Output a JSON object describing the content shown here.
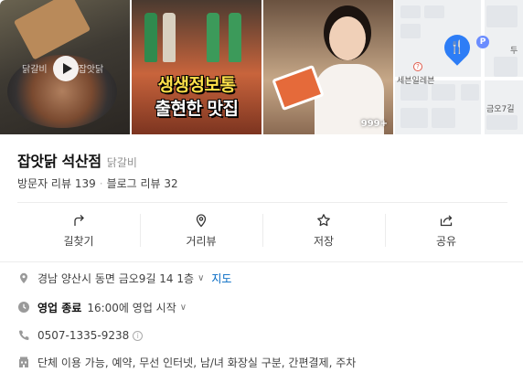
{
  "gallery": {
    "video_caption_left": "닭갈비",
    "video_caption_right": "잡앗닭",
    "overlay_line1": "생생정보통",
    "overlay_line2": "출현한 맛집",
    "photo_count_badge": "999+",
    "map_label_store": "세븐일레븐",
    "map_label_road": "금오7길",
    "map_label_corner": "두",
    "map_p_badge": "P"
  },
  "place": {
    "name": "잡앗닭 석산점",
    "category": "닭갈비"
  },
  "reviews": {
    "visitor": "방문자 리뷰 139",
    "blog": "블로그 리뷰 32"
  },
  "actions": [
    {
      "label": "길찾기",
      "icon": "directions-icon"
    },
    {
      "label": "거리뷰",
      "icon": "location-pin-icon"
    },
    {
      "label": "저장",
      "icon": "star-icon"
    },
    {
      "label": "공유",
      "icon": "share-icon"
    }
  ],
  "details": {
    "address": "경남 양산시 동면 금오9길 14 1층",
    "map_link": "지도",
    "hours_status": "영업 종료",
    "hours_text": "16:00에 영업 시작",
    "phone": "0507-1335-9238",
    "amenities": "단체 이용 가능, 예약, 무선 인터넷, 남/녀 화장실 구분, 간편결제, 주차"
  },
  "colors": {
    "link": "#0068c3",
    "map_pin": "#2d7df6",
    "text_secondary": "#424242"
  }
}
